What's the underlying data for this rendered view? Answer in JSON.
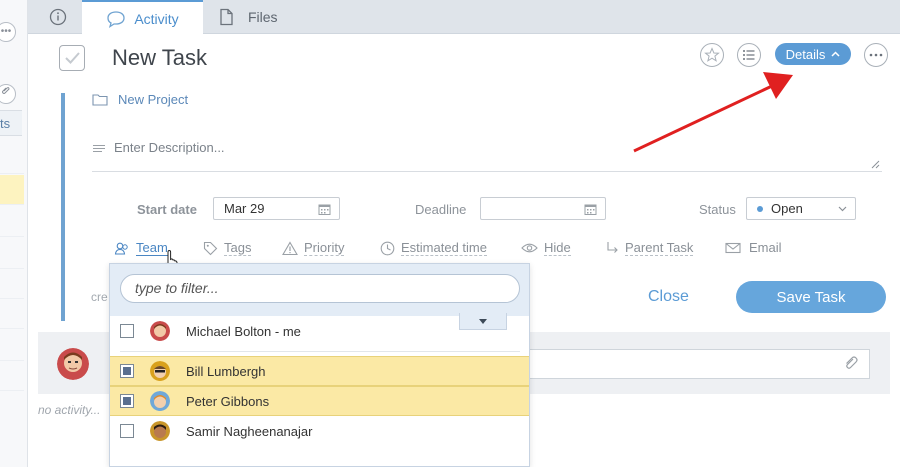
{
  "tabs": [
    {
      "label": "",
      "icon": "info-icon"
    },
    {
      "label": "Activity",
      "icon": "speech-bubble-icon",
      "active": true
    },
    {
      "label": "Files",
      "icon": "file-icon"
    }
  ],
  "left": {
    "partial_label": "ts"
  },
  "task": {
    "title": "New Task",
    "details_label": "Details",
    "project": "New Project",
    "description_placeholder": "Enter Description...",
    "start_date_label": "Start date",
    "start_date_value": "Mar 29",
    "deadline_label": "Deadline",
    "deadline_value": "",
    "status_label": "Status",
    "status_value": "Open",
    "status_color": "#5b9bd5"
  },
  "options": {
    "team": "Team",
    "tags": "Tags",
    "priority": "Priority",
    "estimated_time": "Estimated time",
    "hide": "Hide",
    "parent_task": "Parent Task",
    "email": "Email"
  },
  "actions": {
    "partial_created": "cre",
    "close": "Close",
    "save": "Save Task"
  },
  "activity": {
    "no_activity": "no activity..."
  },
  "team_dropdown": {
    "filter_placeholder": "type to filter...",
    "members": [
      {
        "name": "Michael Bolton - me",
        "checked": false
      },
      {
        "name": "Bill Lumbergh",
        "checked": true
      },
      {
        "name": "Peter Gibbons",
        "checked": true
      },
      {
        "name": "Samir Nagheenanajar",
        "checked": false
      }
    ]
  },
  "colors": {
    "accent": "#5b9bd5",
    "selected_row": "#fbe9a5",
    "arrow": "#e02020"
  }
}
